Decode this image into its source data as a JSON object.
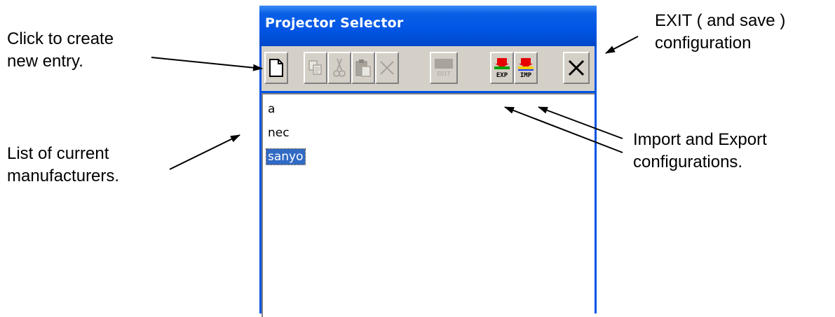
{
  "window": {
    "title": "Projector Selector"
  },
  "toolbar": {
    "buttons": [
      {
        "name": "new",
        "icon": "new-document-icon",
        "enabled": true
      },
      {
        "name": "copy",
        "icon": "copy-icon",
        "enabled": false
      },
      {
        "name": "cut",
        "icon": "scissors-icon",
        "enabled": false
      },
      {
        "name": "paste",
        "icon": "paste-icon",
        "enabled": false
      },
      {
        "name": "delete",
        "icon": "delete-x-icon",
        "enabled": false
      },
      {
        "name": "edit",
        "icon": "edit-icon",
        "label": "EDIT",
        "enabled": false
      },
      {
        "name": "export",
        "icon": "export-icon",
        "label": "EXP",
        "enabled": true
      },
      {
        "name": "import",
        "icon": "import-icon",
        "label": "IMP",
        "enabled": true
      },
      {
        "name": "exit",
        "icon": "close-icon",
        "enabled": true
      }
    ]
  },
  "list": {
    "items": [
      "a",
      "nec",
      "sanyo"
    ],
    "selected": "sanyo"
  },
  "annotations": {
    "create": "Click to create\nnew entry.",
    "list": "List of current\nmanufacturers.",
    "exit": "EXIT ( and save )\nconfiguration",
    "impexp": "Import and Export\nconfigurations."
  },
  "colors": {
    "title_bar": "#0055e5",
    "toolbar_bg": "#d4d0c8",
    "selection": "#316ac5"
  }
}
